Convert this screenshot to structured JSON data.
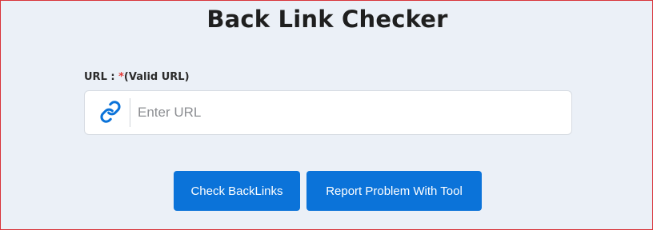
{
  "page": {
    "title": "Back Link Checker"
  },
  "form": {
    "url_label": "URL : ",
    "required_mark": "*",
    "url_hint": "(Valid URL)",
    "url_placeholder": "Enter URL",
    "url_value": ""
  },
  "buttons": {
    "check": "Check BackLinks",
    "report": "Report Problem With Tool"
  },
  "icons": {
    "input_icon": "link-icon"
  },
  "colors": {
    "accent": "#0b73d9",
    "required": "#e53935",
    "background": "#ebf0f7",
    "border": "#d9343a"
  }
}
